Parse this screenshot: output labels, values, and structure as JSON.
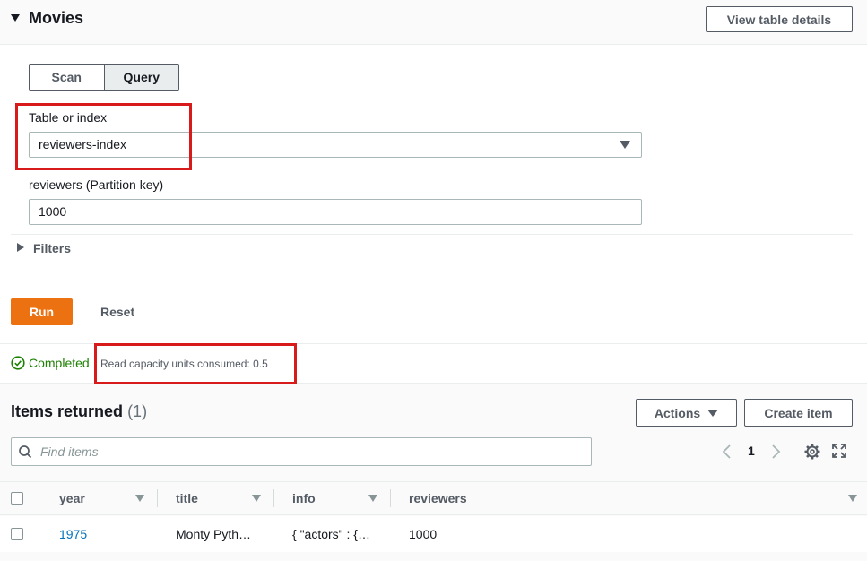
{
  "header": {
    "title": "Movies",
    "view_details_label": "View table details"
  },
  "mode_tabs": [
    {
      "label": "Scan",
      "active": false
    },
    {
      "label": "Query",
      "active": true
    }
  ],
  "table_or_index": {
    "label": "Table or index",
    "value": "reviewers-index"
  },
  "partition_key": {
    "label": "reviewers (Partition key)",
    "value": "1000"
  },
  "filters": {
    "label": "Filters"
  },
  "buttons": {
    "run": "Run",
    "reset": "Reset"
  },
  "status": {
    "completed": "Completed",
    "rcu": "Read capacity units consumed: 0.5"
  },
  "items": {
    "title": "Items returned",
    "count": "(1)",
    "actions_label": "Actions",
    "create_label": "Create item",
    "search_placeholder": "Find items",
    "page": "1"
  },
  "table": {
    "columns": [
      "year",
      "title",
      "info",
      "reviewers"
    ],
    "rows": [
      {
        "year": "1975",
        "title": "Monty Pyth…",
        "info": "{ \"actors\" : {…",
        "reviewers": "1000"
      }
    ]
  },
  "colors": {
    "accent": "#ec7211",
    "success": "#1d8102",
    "link": "#0073bb",
    "highlight": "#d91a1a"
  }
}
